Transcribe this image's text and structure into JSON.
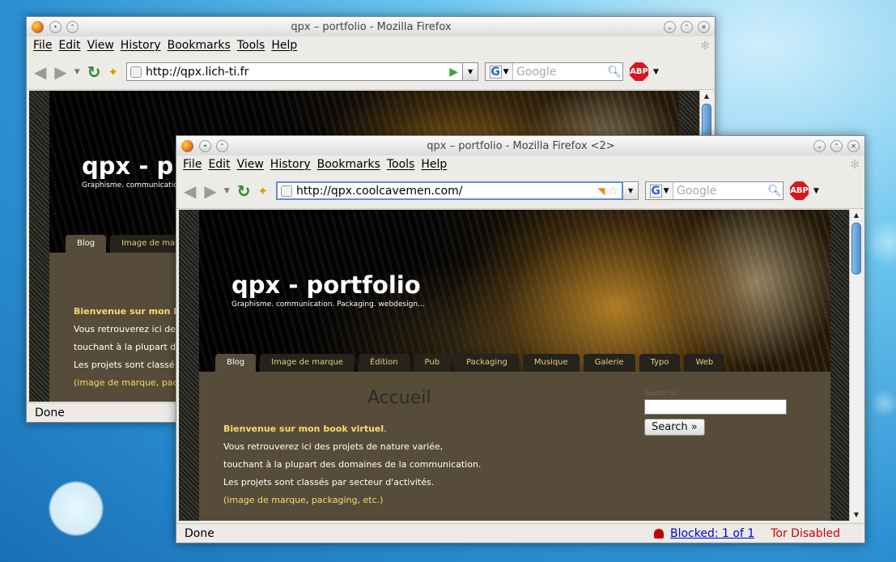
{
  "desktop": {},
  "window_back": {
    "title": "qpx – portfolio - Mozilla Firefox",
    "menu": [
      "File",
      "Edit",
      "View",
      "History",
      "Bookmarks",
      "Tools",
      "Help"
    ],
    "url": "http://qpx.lich-ti.fr",
    "search_placeholder": "Google",
    "adblock_label": "ABP",
    "site": {
      "title": "qpx - p",
      "tagline": "Graphisme. communicatio",
      "tabs": [
        "Blog",
        "Image de marq"
      ],
      "welcome": "Bienvenue sur mon boo",
      "lines": [
        "Vous retrouverez ici de",
        "touchant à la plupart de",
        "Les projets sont classé"
      ],
      "links_prefix": "(",
      "link1": "image de marque",
      "link2": "pack"
    },
    "status": "Done"
  },
  "window_front": {
    "title": "qpx – portfolio - Mozilla Firefox <2>",
    "menu": [
      "File",
      "Edit",
      "View",
      "History",
      "Bookmarks",
      "Tools",
      "Help"
    ],
    "url": "http://qpx.coolcavemen.com/",
    "search_placeholder": "Google",
    "adblock_label": "ABP",
    "site": {
      "title": "qpx - portfolio",
      "tagline": "Graphisme. communication. Packaging. webdesign...",
      "tabs": [
        "Blog",
        "Image de marque",
        "Édition",
        "Pub",
        "Packaging",
        "Musique",
        "Galerie",
        "Typo",
        "Web"
      ],
      "page_heading": "Accueil",
      "welcome": "Bienvenue sur mon book virtuel",
      "welcome_end": ".",
      "lines": [
        "Vous retrouverez ici des projets de nature variée,",
        "touchant à la plupart des domaines de la communication.",
        "Les projets sont classés par secteur d'activités."
      ],
      "paren_open": "(",
      "link1": "image de marque",
      "sep": ", ",
      "link2": "packaging",
      "tail": ", etc.)",
      "search_label": "Search for:",
      "search_button": "Search »"
    },
    "status": "Done",
    "blocked": "Blocked: 1 of 1",
    "tor": "Tor Disabled"
  }
}
